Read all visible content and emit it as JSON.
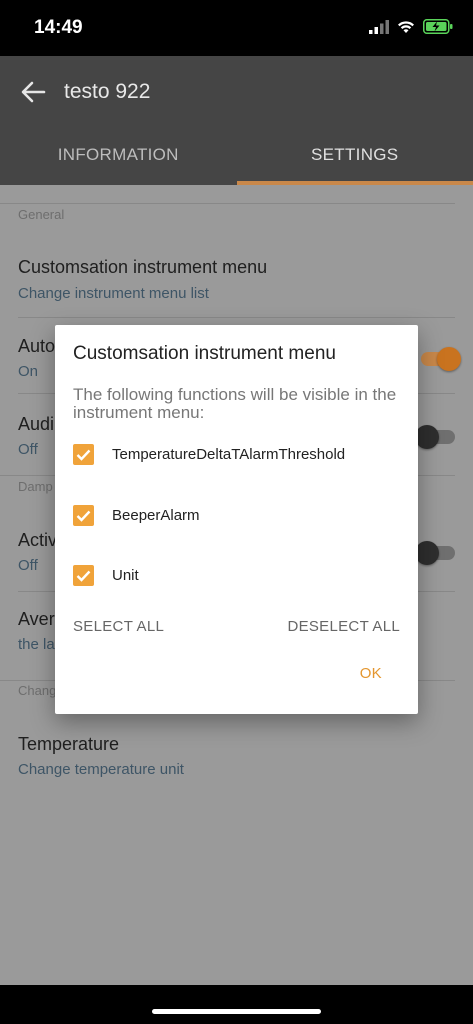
{
  "status_bar": {
    "time": "14:49"
  },
  "app_bar": {
    "title": "testo 922",
    "tabs": [
      {
        "label": "INFORMATION",
        "active": false
      },
      {
        "label": "SETTINGS",
        "active": true
      }
    ]
  },
  "settings": {
    "general_label": "General",
    "customisation": {
      "title": "Customsation instrument menu",
      "subtitle": "Change instrument menu list"
    },
    "auto_item": {
      "title": "Auto",
      "value": "On",
      "toggle_on": true
    },
    "audio_item": {
      "title": "Audi",
      "value": "Off",
      "toggle_on": false
    },
    "damp_label": "Damp",
    "active_item": {
      "title": "Activ",
      "value": "Off",
      "toggle_on": false
    },
    "average_item": {
      "title": "Aver",
      "subtitle": "the la"
    },
    "change_label": "Chang",
    "temperature": {
      "title": "Temperature",
      "subtitle": "Change temperature unit"
    }
  },
  "dialog": {
    "title": "Customsation instrument menu",
    "message": "The following functions will be visible in the instrument menu:",
    "options": [
      {
        "label": "TemperatureDeltaTAlarmThreshold",
        "checked": true
      },
      {
        "label": "BeeperAlarm",
        "checked": true
      },
      {
        "label": "Unit",
        "checked": true
      }
    ],
    "select_all": "SELECT ALL",
    "deselect_all": "DESELECT ALL",
    "ok": "OK"
  },
  "colors": {
    "accent": "#c9884a",
    "checkbox": "#f0a33a",
    "ok_button": "#e4962e",
    "app_bar": "#454545",
    "scrim_background": "#9a9a9a"
  }
}
